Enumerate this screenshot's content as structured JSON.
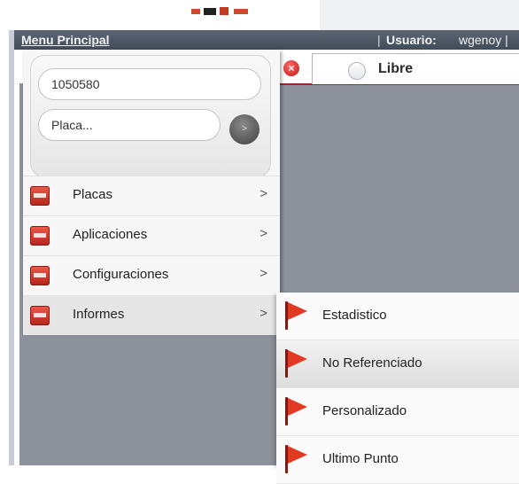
{
  "menubar": {
    "title": "Menu Principal",
    "separator": "|",
    "user_label": "Usuario:",
    "user_name": "wgenoy |"
  },
  "tab": {
    "label": "Libre"
  },
  "search": {
    "id_value": "1050580",
    "plate_placeholder": "Placa...",
    "go_label": ">"
  },
  "menu": {
    "items": [
      {
        "label": "Placas",
        "arrow": ">"
      },
      {
        "label": "Aplicaciones",
        "arrow": ">"
      },
      {
        "label": "Configuraciones",
        "arrow": ">"
      },
      {
        "label": "Informes",
        "arrow": ">"
      }
    ]
  },
  "submenu": {
    "items": [
      {
        "label": "Estadistico"
      },
      {
        "label": "No Referenciado"
      },
      {
        "label": "Personalizado"
      },
      {
        "label": "Ultimo Punto"
      }
    ]
  },
  "colors": {
    "menubar": "#4f5865",
    "content": "#8c919b",
    "accent_red": "#e23a22",
    "tab_border": "#9a2b2b"
  },
  "icons": {
    "tab_close": "close-circle-icon",
    "go": "arrow-right-icon",
    "flag": "red-flag-icon"
  }
}
